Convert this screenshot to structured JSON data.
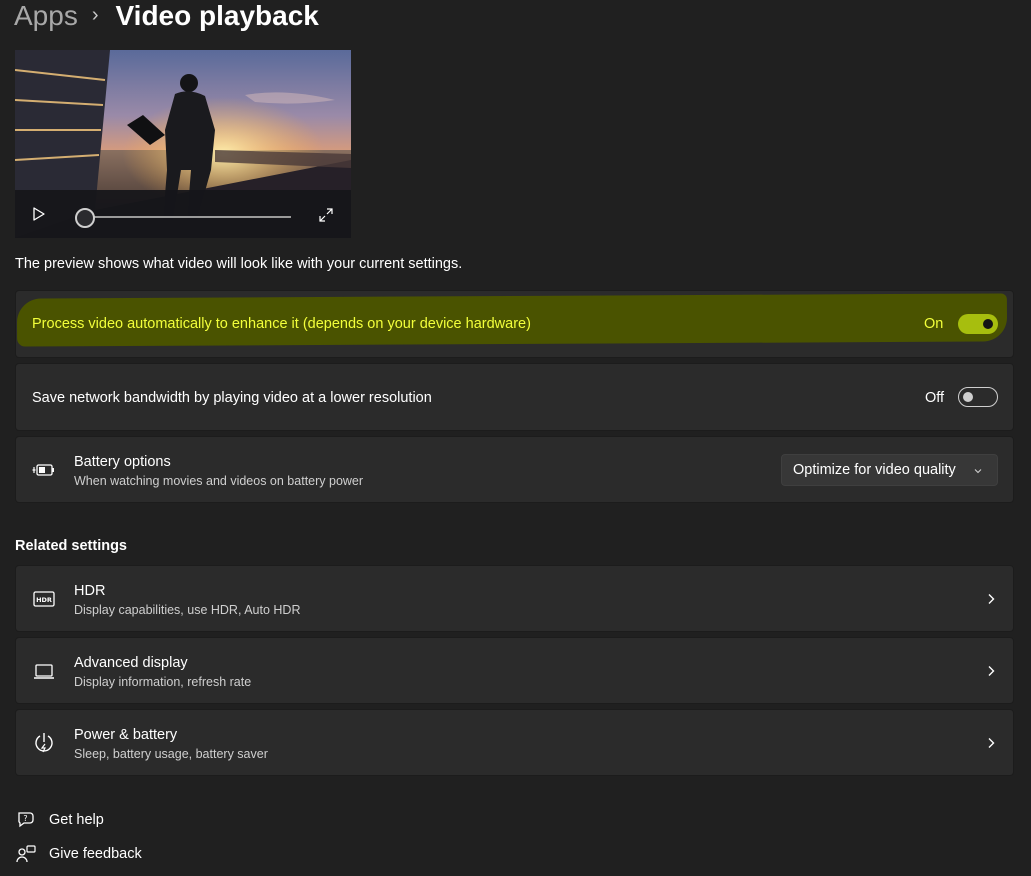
{
  "breadcrumb": {
    "parent": "Apps",
    "current": "Video playback"
  },
  "preview": {
    "note": "The preview shows what video will look like with your current settings."
  },
  "settings": [
    {
      "label": "Process video automatically to enhance it (depends on your device hardware)",
      "state": "On",
      "highlighted": true
    },
    {
      "label": "Save network bandwidth by playing video at a lower resolution",
      "state": "Off"
    }
  ],
  "battery": {
    "title": "Battery options",
    "subtitle": "When watching movies and videos on battery power",
    "selected": "Optimize for video quality",
    "icon": "battery-saver-icon"
  },
  "related": {
    "heading": "Related settings",
    "items": [
      {
        "title": "HDR",
        "subtitle": "Display capabilities, use HDR, Auto HDR",
        "icon": "hdr-icon"
      },
      {
        "title": "Advanced display",
        "subtitle": "Display information, refresh rate",
        "icon": "laptop-icon"
      },
      {
        "title": "Power & battery",
        "subtitle": "Sleep, battery usage, battery saver",
        "icon": "power-icon"
      }
    ]
  },
  "footer": {
    "help": "Get help",
    "feedback": "Give feedback"
  },
  "colors": {
    "accent": "#a7be0e",
    "highlight": "#4a5300",
    "highlight_text": "#f2ff3a"
  }
}
